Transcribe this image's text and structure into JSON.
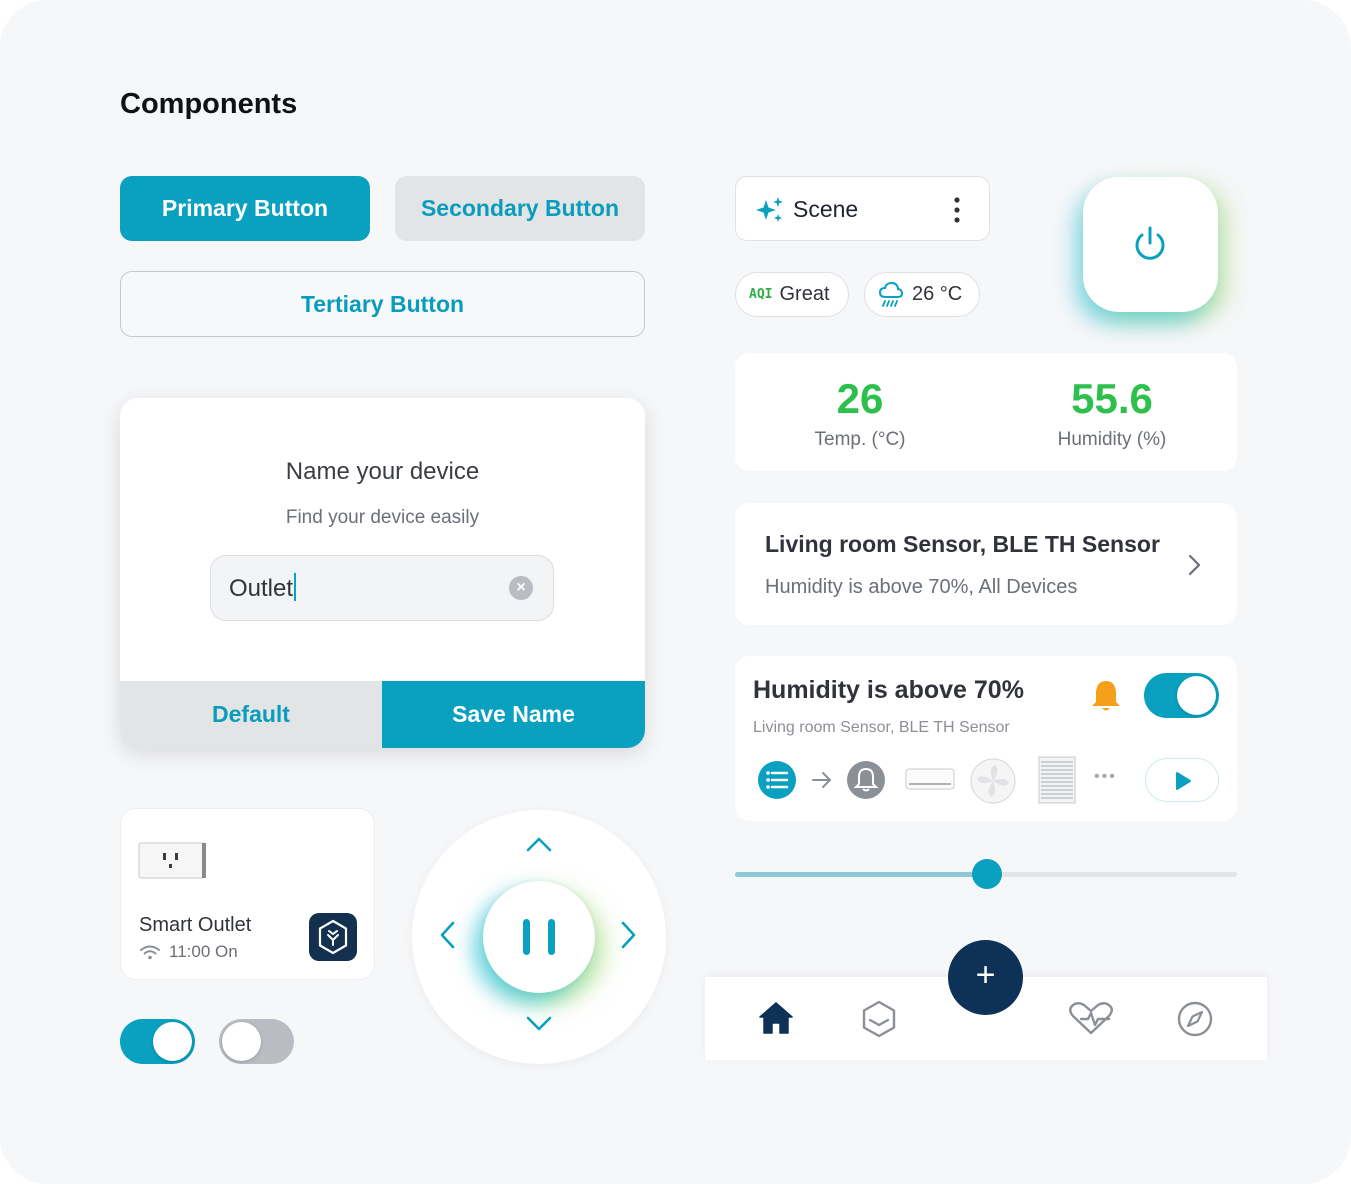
{
  "page": {
    "title": "Components"
  },
  "buttons": {
    "primary": "Primary Button",
    "secondary": "Secondary Button",
    "tertiary": "Tertiary Button"
  },
  "dialog": {
    "title": "Name your device",
    "subtitle": "Find your device easily",
    "input_value": "Outlet",
    "default_label": "Default",
    "save_label": "Save Name"
  },
  "outlet_card": {
    "name": "Smart Outlet",
    "status": "11:00 On"
  },
  "toggles": {
    "first_on": true,
    "second_on": false
  },
  "scene": {
    "label": "Scene"
  },
  "chips": {
    "aqi_tag": "AQI",
    "aqi_value": "Great",
    "weather_temp": "26 °C"
  },
  "stats": {
    "temp_value": "26",
    "temp_label": "Temp. (°C)",
    "humidity_value": "55.6",
    "humidity_label": "Humidity (%)"
  },
  "sensor_card": {
    "title": "Living room Sensor, BLE TH Sensor",
    "subtitle": "Humidity is above 70%, All Devices"
  },
  "automation": {
    "title": "Humidity is above 70%",
    "subtitle": "Living room Sensor, BLE TH Sensor",
    "enabled": true,
    "more": "•••"
  },
  "slider": {
    "value": 0.5
  },
  "tabbar": {
    "items": [
      "home-icon",
      "device-hexagon-icon",
      "health-heart-icon",
      "compass-icon"
    ],
    "fab": "+"
  },
  "colors": {
    "accent": "#0aa0c0",
    "accent_text": "#0a9cbc",
    "green": "#2ec04c",
    "navy": "#0e3157",
    "bell": "#f5a01a"
  }
}
